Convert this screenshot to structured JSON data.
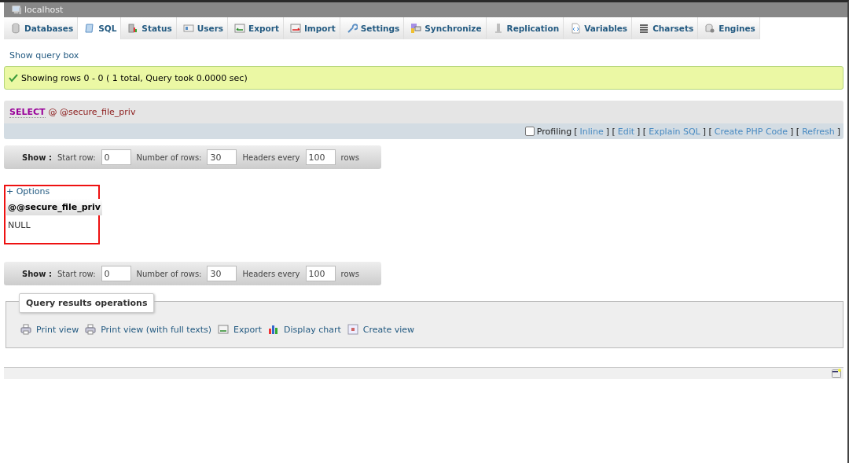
{
  "window": {
    "title": "localhost"
  },
  "tabs": [
    {
      "label": "Databases",
      "selected": false
    },
    {
      "label": "SQL",
      "selected": true
    },
    {
      "label": "Status",
      "selected": false
    },
    {
      "label": "Users",
      "selected": false
    },
    {
      "label": "Export",
      "selected": false
    },
    {
      "label": "Import",
      "selected": false
    },
    {
      "label": "Settings",
      "selected": false
    },
    {
      "label": "Synchronize",
      "selected": false
    },
    {
      "label": "Replication",
      "selected": false
    },
    {
      "label": "Variables",
      "selected": false
    },
    {
      "label": "Charsets",
      "selected": false
    },
    {
      "label": "Engines",
      "selected": false
    }
  ],
  "show_query_box": "Show query box",
  "message": "Showing rows 0 - 0 ( 1 total, Query took 0.0000 sec)",
  "query": {
    "keyword": "SELECT",
    "rest": "@ @secure_file_priv"
  },
  "profiling": {
    "label": "Profiling",
    "checked": false,
    "items": [
      {
        "kind": "bracket",
        "text": "["
      },
      {
        "kind": "link",
        "text": "Inline"
      },
      {
        "kind": "bracket",
        "text": "] ["
      },
      {
        "kind": "link",
        "text": "Edit"
      },
      {
        "kind": "bracket",
        "text": "] ["
      },
      {
        "kind": "link",
        "text": "Explain SQL"
      },
      {
        "kind": "bracket",
        "text": "] ["
      },
      {
        "kind": "link",
        "text": "Create PHP Code"
      },
      {
        "kind": "bracket",
        "text": "] ["
      },
      {
        "kind": "link",
        "text": "Refresh"
      },
      {
        "kind": "bracket",
        "text": "]"
      }
    ]
  },
  "nav_top": {
    "show": "Show :",
    "start_label": "Start row:",
    "start": "0",
    "rows_label": "Number of rows:",
    "rows": "30",
    "headers_label": "Headers every",
    "headers": "100",
    "unit": "rows"
  },
  "results": {
    "options": "+ Options",
    "annotated": true,
    "column": "@@secure_file_priv",
    "rows": [
      "NULL"
    ]
  },
  "nav_bottom": {
    "show": "Show :",
    "start_label": "Start row:",
    "start": "0",
    "rows_label": "Number of rows:",
    "rows": "30",
    "headers_label": "Headers every",
    "headers": "100",
    "unit": "rows"
  },
  "operations": {
    "legend": "Query results operations",
    "links": [
      "Print view",
      "Print view (with full texts)",
      "Export",
      "Display chart",
      "Create view"
    ]
  }
}
